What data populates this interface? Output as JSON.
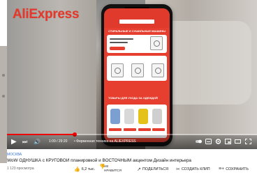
{
  "video": {
    "brand_overlay": "AliExpress",
    "phone_screen": {
      "section1_title": "СТИРАЛЬНЫЕ И СУШИЛЬНЫЕ МАШИНЫ",
      "section2_title": "ТОВАРЫ ДЛЯ УХОДА ЗА ОДЕЖДОЙ"
    },
    "progress": 0.27,
    "time_text": "1:09 / 29:20",
    "chapter_text": "• Фирменная техника на ALIEXPRESS",
    "accent_color": "#e63f2f"
  },
  "controls": {
    "play_icon": "play-icon",
    "next_icon": "next-icon",
    "volume_icon": "volume-icon",
    "right_icons": [
      "autoplay-toggle-icon",
      "subtitles-icon",
      "settings-icon",
      "miniplayer-icon",
      "theater-icon",
      "fullscreen-icon"
    ]
  },
  "meta": {
    "channel": "МОСКВА",
    "title": "WoW ОДНУШКА с КРУГОВОЙ планировкой и ВОСТОЧНЫМ акцентом Дизайн интерьера",
    "views": "1 123 просмотра"
  },
  "actions": {
    "like": "6,2 тыс.",
    "dislike_line1": "НЕ",
    "dislike_line2": "НРАВИТСЯ",
    "share": "ПОДЕЛИТЬСЯ",
    "clip": "СОЗДАТЬ КЛИП",
    "save": "СОХРАНИТЬ"
  }
}
